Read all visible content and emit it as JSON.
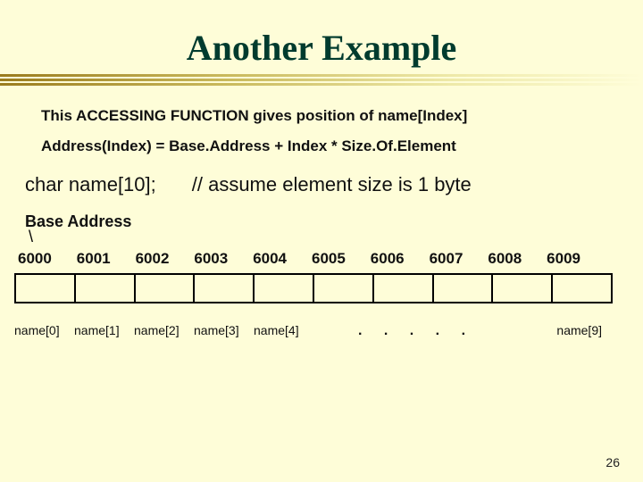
{
  "title": "Another Example",
  "line1": "This ACCESSING FUNCTION gives position of name[Index]",
  "line2": "Address(Index) = Base.Address + Index * Size.Of.Element",
  "decl": "char  name[10];",
  "comment": "// assume element size is 1 byte",
  "baseLabel": "Base Address",
  "slash": "\\",
  "addresses": [
    "6000",
    "6001",
    "6002",
    "6003",
    "6004",
    "6005",
    "6006",
    "6007",
    "6008",
    "6009"
  ],
  "bottomLabels": [
    "name[0]",
    "name[1]",
    "name[2]",
    "name[3]",
    "name[4]"
  ],
  "dots": ".  .  .  .  .",
  "lastLabel": "name[9]",
  "pageNum": "26"
}
